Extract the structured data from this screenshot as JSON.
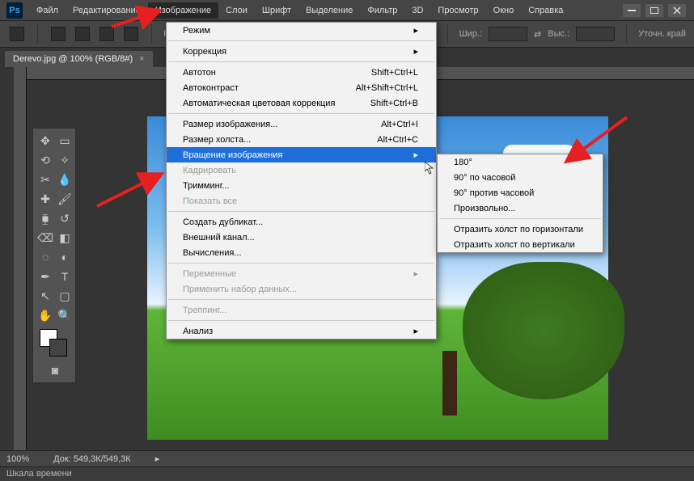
{
  "app": {
    "logo": "Ps"
  },
  "menubar": [
    "Файл",
    "Редактирование",
    "Изображение",
    "Слои",
    "Шрифт",
    "Выделение",
    "Фильтр",
    "3D",
    "Просмотр",
    "Окно",
    "Справка"
  ],
  "optionsbar": {
    "tool_prefix": "Ра",
    "width_label": "Шир.:",
    "height_label": "Выс.:",
    "button": "Уточн. край"
  },
  "document": {
    "tab_title": "Derevo.jpg @ 100% (RGB/8#)",
    "close": "×"
  },
  "dropdown1": [
    {
      "label": "Режим",
      "submenu": true
    },
    {
      "sep": true
    },
    {
      "label": "Коррекция",
      "submenu": true
    },
    {
      "sep": true
    },
    {
      "label": "Автотон",
      "shortcut": "Shift+Ctrl+L"
    },
    {
      "label": "Автоконтраст",
      "shortcut": "Alt+Shift+Ctrl+L"
    },
    {
      "label": "Автоматическая цветовая коррекция",
      "shortcut": "Shift+Ctrl+B"
    },
    {
      "sep": true
    },
    {
      "label": "Размер изображения...",
      "shortcut": "Alt+Ctrl+I"
    },
    {
      "label": "Размер холста...",
      "shortcut": "Alt+Ctrl+C"
    },
    {
      "label": "Вращение изображения",
      "submenu": true,
      "highlight": true
    },
    {
      "label": "Кадрировать",
      "disabled": true
    },
    {
      "label": "Тримминг..."
    },
    {
      "label": "Показать все",
      "disabled": true
    },
    {
      "sep": true
    },
    {
      "label": "Создать дубликат..."
    },
    {
      "label": "Внешний канал..."
    },
    {
      "label": "Вычисления..."
    },
    {
      "sep": true
    },
    {
      "label": "Переменные",
      "submenu": true,
      "disabled": true
    },
    {
      "label": "Применить набор данных...",
      "disabled": true
    },
    {
      "sep": true
    },
    {
      "label": "Треппинг...",
      "disabled": true
    },
    {
      "sep": true
    },
    {
      "label": "Анализ",
      "submenu": true
    }
  ],
  "dropdown2": [
    {
      "label": "180°"
    },
    {
      "label": "90° по часовой"
    },
    {
      "label": "90° против часовой"
    },
    {
      "label": "Произвольно..."
    },
    {
      "sep": true
    },
    {
      "label": "Отразить холст по горизонтали"
    },
    {
      "label": "Отразить холст по вертикали"
    }
  ],
  "status": {
    "zoom": "100%",
    "docsize": "Док: 549,3К/549,3К"
  },
  "timeline": {
    "label": "Шкала времени"
  },
  "tools": [
    "move",
    "marquee",
    "lasso",
    "wand",
    "crop",
    "eyedropper",
    "heal",
    "brush",
    "stamp",
    "history",
    "eraser",
    "gradient",
    "blur",
    "dodge",
    "pen",
    "type",
    "path",
    "shape",
    "hand",
    "zoom"
  ]
}
